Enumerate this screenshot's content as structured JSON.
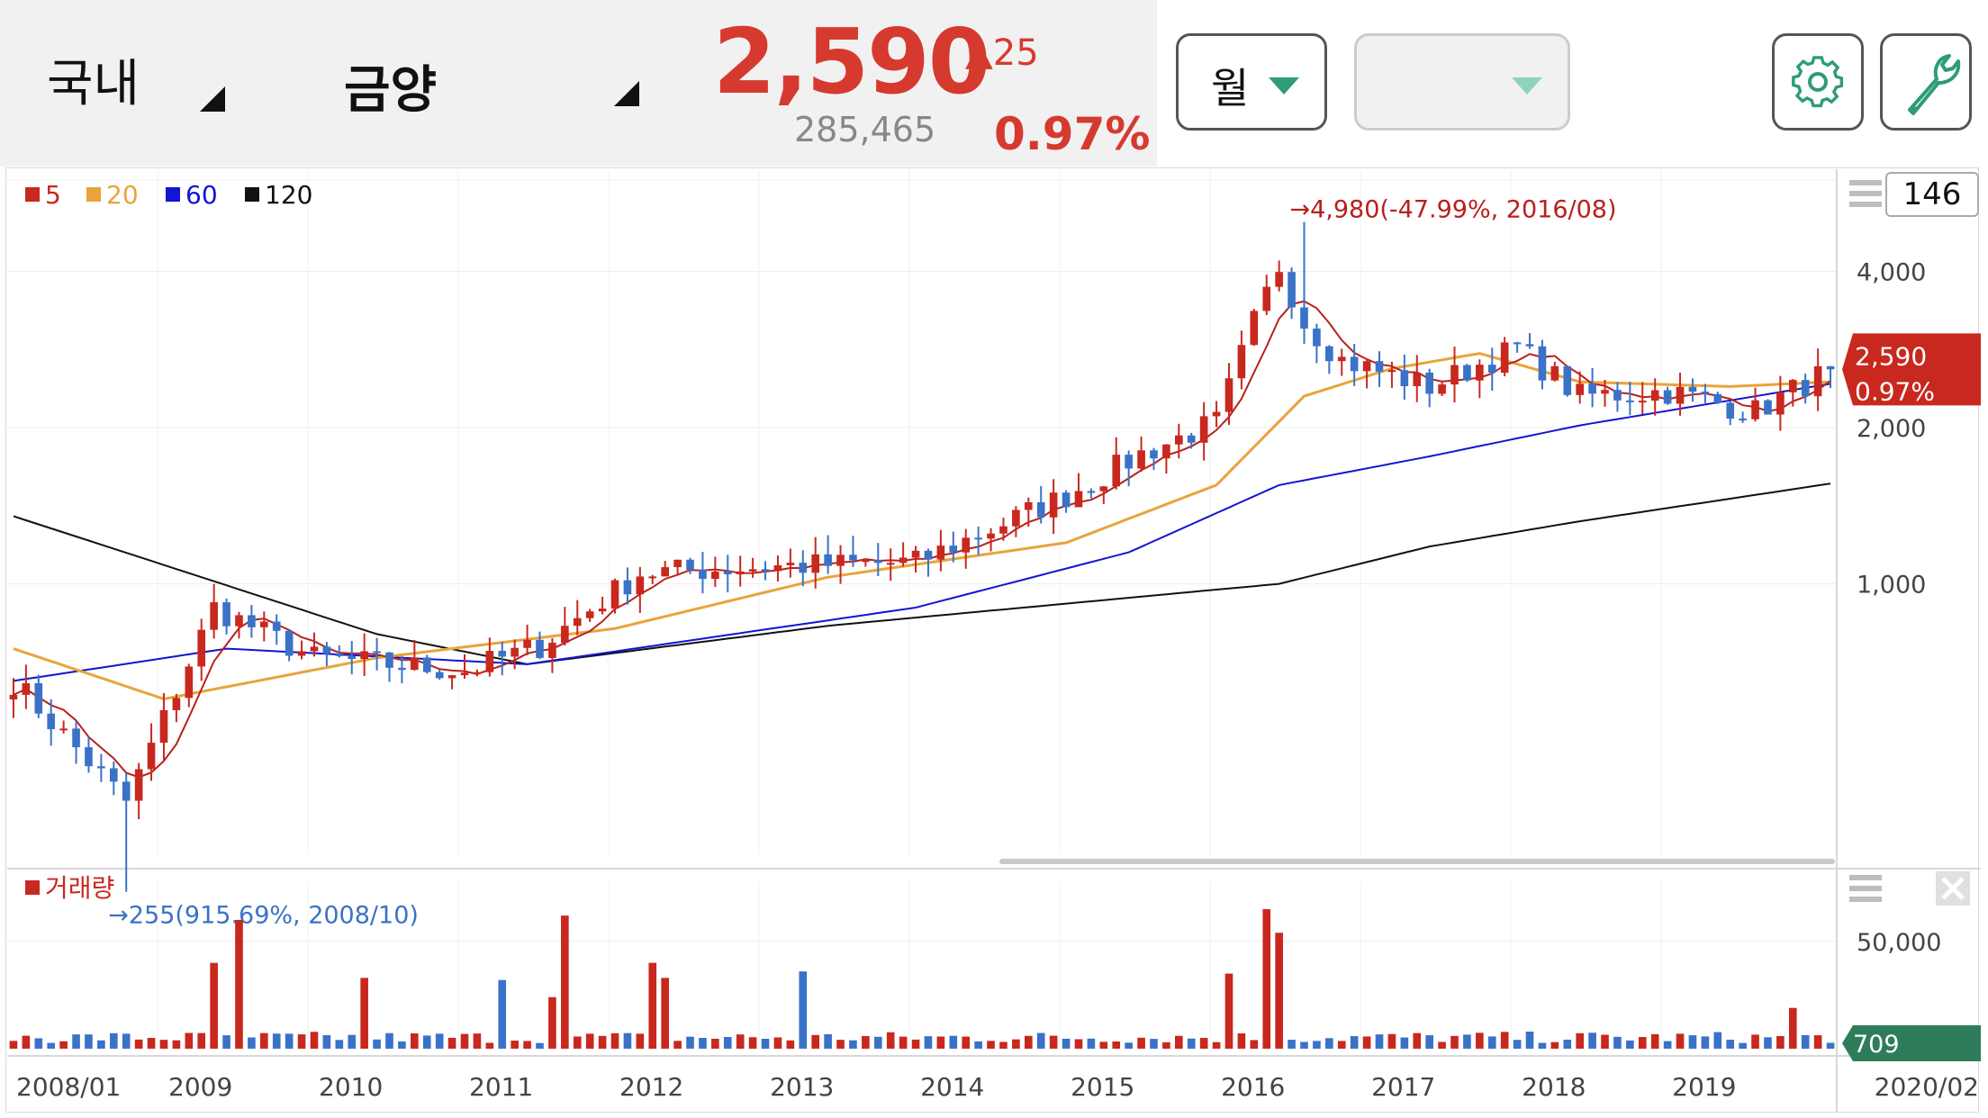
{
  "header": {
    "market": "국내",
    "stock_name": "금양",
    "price": "2,590",
    "change": "▲25",
    "volume": "285,465",
    "change_pct": "0.97%",
    "period_label": "월",
    "secondary_select": "",
    "settings_icon": "gear-icon",
    "tools_icon": "wrench-icon",
    "zoom_value": "146"
  },
  "colors": {
    "up": "#c8281e",
    "down": "#3a72c8",
    "ma5": "#b8201c",
    "ma20": "#e8a43a",
    "ma60": "#1414d2",
    "ma120": "#111111",
    "vol_badge": "#2e7d5a"
  },
  "chart_data": {
    "type": "candlestick",
    "legend": [
      {
        "label": "5",
        "color": "#c8281e"
      },
      {
        "label": "20",
        "color": "#e8a43a"
      },
      {
        "label": "60",
        "color": "#1414d2"
      },
      {
        "label": "120",
        "color": "#111111"
      }
    ],
    "y_ticks": [
      "4,000",
      "2,000",
      "1,000"
    ],
    "y_tick_values": [
      4000,
      2000,
      1000
    ],
    "y_scale": "log",
    "ylim": [
      300,
      6000
    ],
    "x_ticks": [
      "2008/01",
      "2009",
      "2010",
      "2011",
      "2012",
      "2013",
      "2014",
      "2015",
      "2016",
      "2017",
      "2018",
      "2019",
      "2020/02"
    ],
    "x_range": [
      "2008/01",
      "2020/02"
    ],
    "max_annotation": "→4,980(-47.99%, 2016/08)",
    "max_point": {
      "date": "2016/08",
      "value": 4980
    },
    "min_annotation": "→255(915.69%, 2008/10)",
    "min_point": {
      "date": "2008/10",
      "value": 255
    },
    "last_price_label": "2,590",
    "last_pct_label": "0.97%",
    "last_price": 2590,
    "candles_keypoints": [
      {
        "date": "2008/01",
        "close": 650
      },
      {
        "date": "2008/10",
        "close": 380
      },
      {
        "date": "2009/05",
        "close": 900
      },
      {
        "date": "2010/01",
        "close": 720
      },
      {
        "date": "2011/01",
        "close": 680
      },
      {
        "date": "2011/07",
        "close": 760
      },
      {
        "date": "2012/03",
        "close": 1050
      },
      {
        "date": "2013/01",
        "close": 1080
      },
      {
        "date": "2014/01",
        "close": 1100
      },
      {
        "date": "2015/01",
        "close": 1480
      },
      {
        "date": "2015/07",
        "close": 1780
      },
      {
        "date": "2016/01",
        "close": 2050
      },
      {
        "date": "2016/04",
        "close": 3200
      },
      {
        "date": "2016/06",
        "close": 4100
      },
      {
        "date": "2016/08",
        "close": 3200
      },
      {
        "date": "2016/11",
        "close": 2700
      },
      {
        "date": "2017/06",
        "close": 2400
      },
      {
        "date": "2018/01",
        "close": 2850
      },
      {
        "date": "2018/06",
        "close": 2300
      },
      {
        "date": "2019/01",
        "close": 2350
      },
      {
        "date": "2019/08",
        "close": 2150
      },
      {
        "date": "2020/02",
        "close": 2590
      }
    ],
    "ma120_keypoints": [
      {
        "date": "2008/01",
        "value": 1350
      },
      {
        "date": "2010/06",
        "value": 800
      },
      {
        "date": "2011/06",
        "value": 700
      },
      {
        "date": "2013/06",
        "value": 830
      },
      {
        "date": "2015/06",
        "value": 940
      },
      {
        "date": "2016/06",
        "value": 1000
      },
      {
        "date": "2017/06",
        "value": 1180
      },
      {
        "date": "2018/06",
        "value": 1320
      },
      {
        "date": "2020/02",
        "value": 1560
      }
    ],
    "ma60_keypoints": [
      {
        "date": "2008/01",
        "value": 650
      },
      {
        "date": "2009/06",
        "value": 750
      },
      {
        "date": "2011/06",
        "value": 700
      },
      {
        "date": "2014/01",
        "value": 900
      },
      {
        "date": "2015/06",
        "value": 1150
      },
      {
        "date": "2016/06",
        "value": 1550
      },
      {
        "date": "2017/06",
        "value": 1760
      },
      {
        "date": "2018/06",
        "value": 2020
      },
      {
        "date": "2020/02",
        "value": 2430
      }
    ],
    "ma20_keypoints": [
      {
        "date": "2008/01",
        "value": 750
      },
      {
        "date": "2009/01",
        "value": 600
      },
      {
        "date": "2010/06",
        "value": 720
      },
      {
        "date": "2012/01",
        "value": 820
      },
      {
        "date": "2013/06",
        "value": 1030
      },
      {
        "date": "2015/01",
        "value": 1200
      },
      {
        "date": "2016/01",
        "value": 1550
      },
      {
        "date": "2016/08",
        "value": 2300
      },
      {
        "date": "2017/03",
        "value": 2600
      },
      {
        "date": "2017/10",
        "value": 2780
      },
      {
        "date": "2018/06",
        "value": 2450
      },
      {
        "date": "2019/06",
        "value": 2400
      },
      {
        "date": "2020/02",
        "value": 2450
      }
    ],
    "volume_label": "거래량",
    "volume_y_tick": "50,000",
    "volume_y_tick_value": 50000,
    "last_volume_label": "709",
    "volume_spikes": [
      {
        "date": "2009/05",
        "value": 40000
      },
      {
        "date": "2009/07",
        "value": 60000
      },
      {
        "date": "2010/05",
        "value": 33000
      },
      {
        "date": "2011/04",
        "value": 32000
      },
      {
        "date": "2011/08",
        "value": 24000
      },
      {
        "date": "2011/09",
        "value": 62000
      },
      {
        "date": "2012/04",
        "value": 40000
      },
      {
        "date": "2012/05",
        "value": 33000
      },
      {
        "date": "2013/04",
        "value": 36000
      },
      {
        "date": "2016/02",
        "value": 35000
      },
      {
        "date": "2016/05",
        "value": 65000
      },
      {
        "date": "2016/06",
        "value": 54000
      },
      {
        "date": "2019/11",
        "value": 19000
      }
    ]
  }
}
